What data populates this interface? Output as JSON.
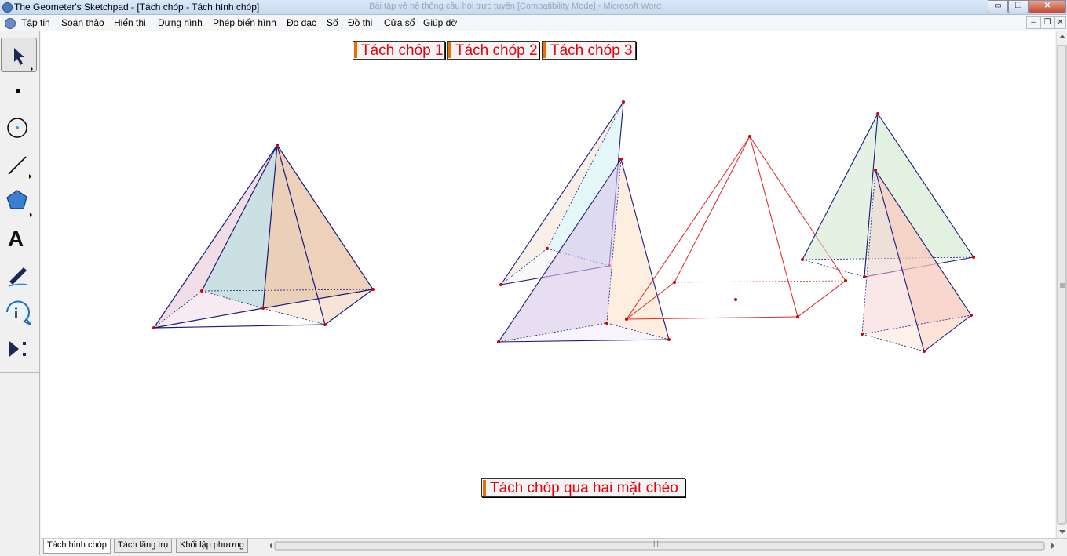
{
  "window": {
    "title": "The Geometer's Sketchpad - [Tách chóp - Tách hình chóp]",
    "background_title": "Bài tập về hệ thống câu hỏi trực tuyến [Compatibility Mode] - Microsoft Word"
  },
  "window_controls": {
    "minimize": "▭",
    "restore": "❐",
    "close": "✕"
  },
  "menu": {
    "items": [
      "Tập tin",
      "Soạn thảo",
      "Hiển thị",
      "Dựng hình",
      "Phép biến hình",
      "Đo đạc",
      "Số",
      "Đồ thị",
      "Cửa sổ",
      "Giúp đỡ"
    ]
  },
  "mdi_controls": {
    "minimize": "–",
    "restore": "❐",
    "close": "✕"
  },
  "toolbox": {
    "tools": [
      {
        "name": "arrow-tool-icon",
        "selected": true
      },
      {
        "name": "point-tool-icon"
      },
      {
        "name": "compass-tool-icon"
      },
      {
        "name": "straightedge-tool-icon"
      },
      {
        "name": "polygon-tool-icon"
      },
      {
        "name": "text-tool-icon",
        "glyph": "A"
      },
      {
        "name": "marker-tool-icon"
      },
      {
        "name": "information-tool-icon"
      },
      {
        "name": "custom-tool-icon"
      }
    ]
  },
  "canvas": {
    "buttons": {
      "split1": "Tách chóp 1",
      "split2": "Tách chóp 2",
      "split3": "Tách chóp 3",
      "diagonal": "Tách chóp qua hai mặt chéo"
    }
  },
  "tabs": [
    "Tách hình chóp",
    "Tách lăng trụ",
    "Khối lập phương"
  ],
  "scroll": {
    "grip": "|||"
  },
  "colors": {
    "button_text": "#e8000a",
    "button_handle": "#e87200",
    "edge_blue": "#1a1a7a",
    "edge_red": "#e53030",
    "point_red": "#cc0000"
  }
}
